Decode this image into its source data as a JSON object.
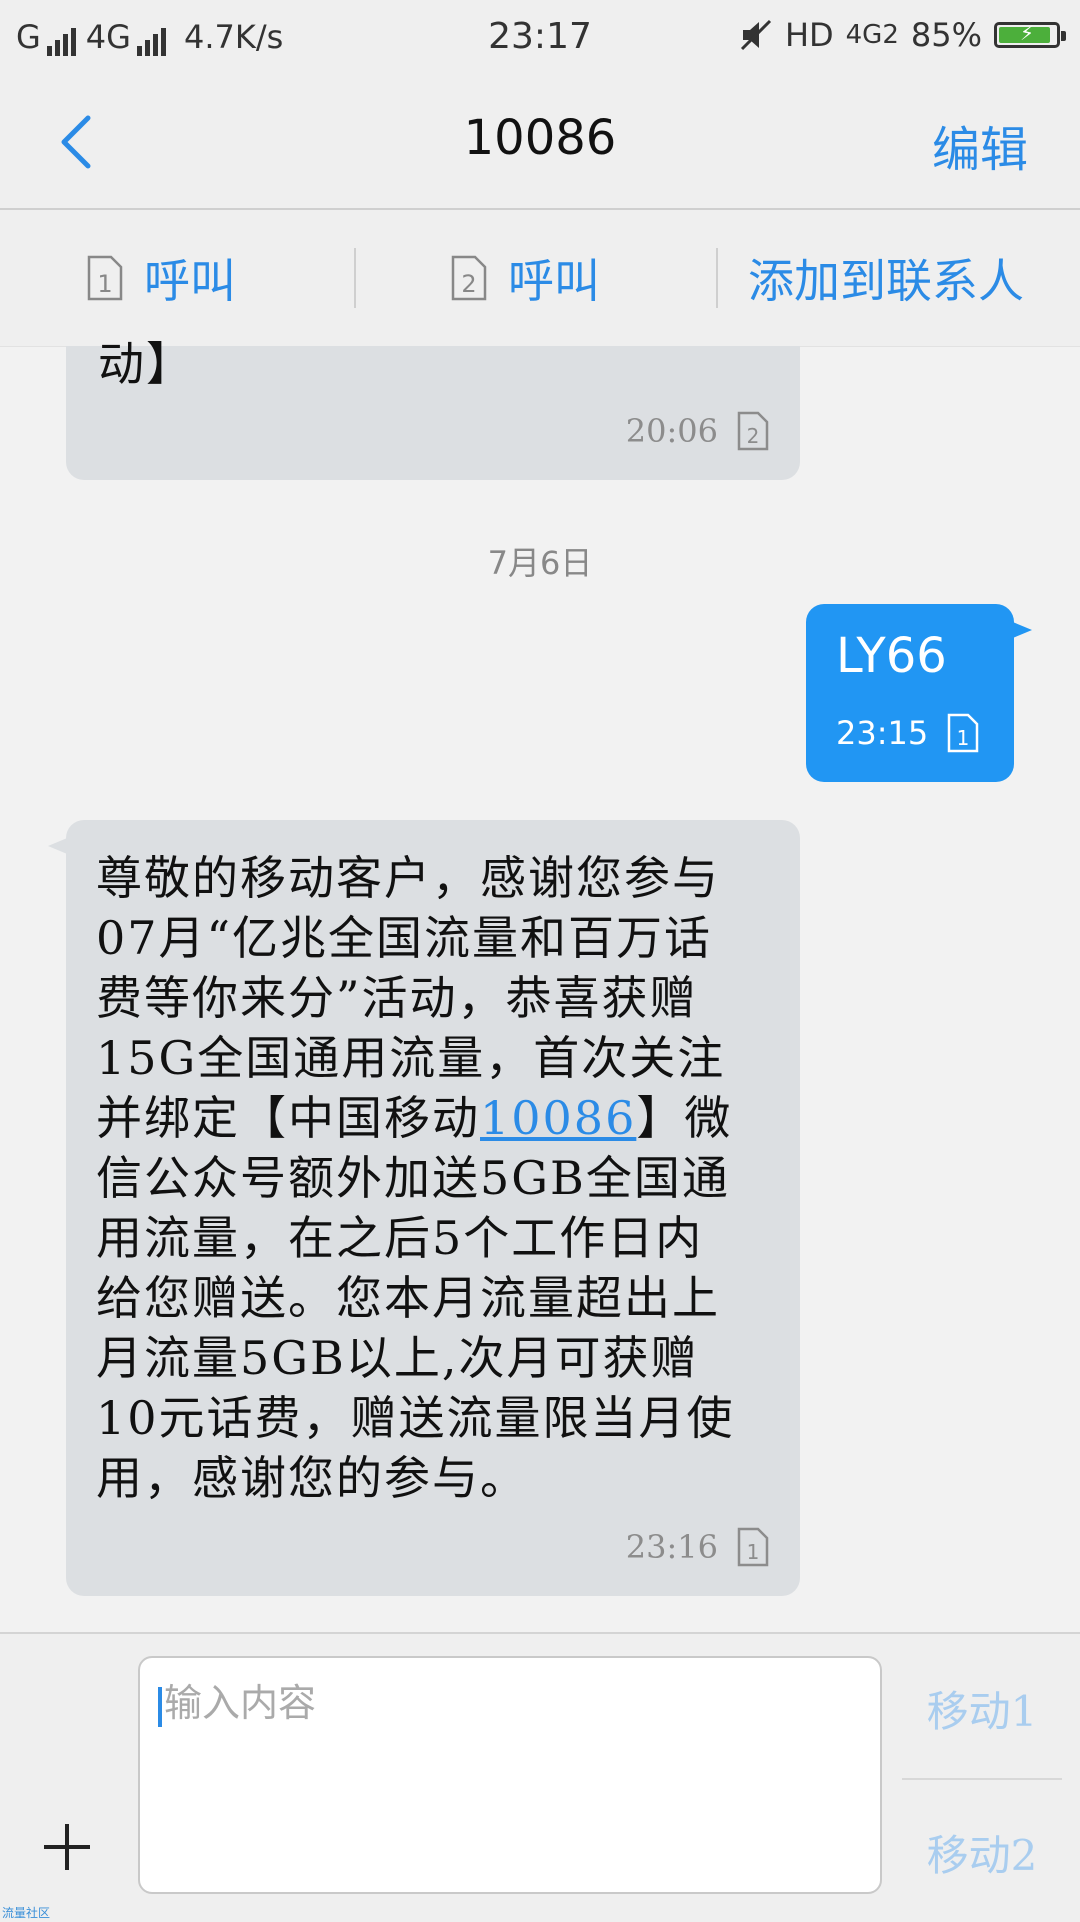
{
  "status_bar": {
    "carrier1": "G",
    "carrier2": "4G",
    "speed": "4.7K/s",
    "time": "23:17",
    "hd": "HD",
    "network": "4G2",
    "battery": "85%",
    "battery_level": 0.85,
    "battery_color": "#4caf3b"
  },
  "header": {
    "title": "10086",
    "edit_label": "编辑"
  },
  "actions": {
    "call1_label": "呼叫",
    "call1_sim": "1",
    "call2_label": "呼叫",
    "call2_sim": "2",
    "add_contact_label": "添加到联系人"
  },
  "messages": {
    "prev_partial_text": "动】",
    "prev_time": "20:06",
    "prev_sim": "2",
    "date_separator": "7月6日",
    "sent_text": "LY66",
    "sent_time": "23:15",
    "sent_sim": "1",
    "received_text_before_link": "尊敬的移动客户，感谢您参与\n07月“亿兆全国流量和百万话\n费等你来分”活动，恭喜获赠\n15G全国通用流量，首次关注\n并绑定【中国移动",
    "received_link": "10086",
    "received_text_after_link": "】微\n信公众号额外加送5GB全国通\n用流量，在之后5个工作日内\n给您赠送。您本月流量超出上\n月流量5GB以上,次月可获赠\n10元话费，赠送流量限当月使\n用，感谢您的参与。",
    "received_time": "23:16",
    "received_sim": "1"
  },
  "composer": {
    "placeholder": "输入内容",
    "send1_label": "移动1",
    "send2_label": "移动2"
  },
  "watermark": "流量社区",
  "colors": {
    "accent": "#2b8be6",
    "sent_bubble": "#2196f3",
    "received_bubble": "#dcdfe2"
  }
}
